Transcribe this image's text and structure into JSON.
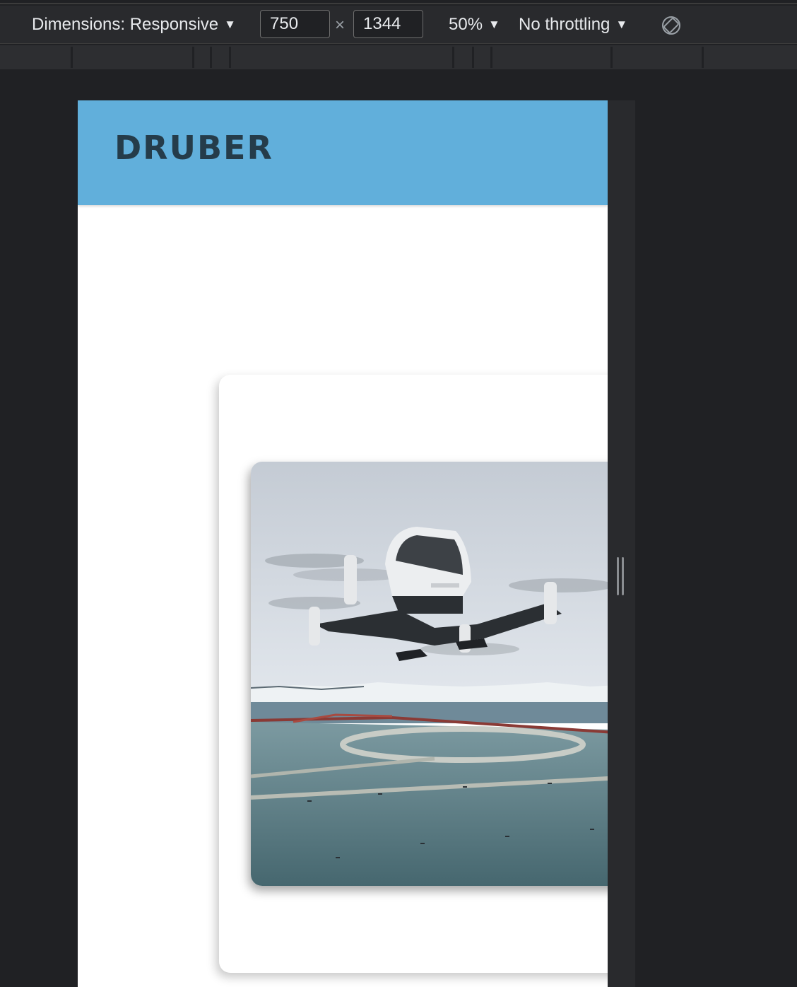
{
  "devtools": {
    "dimensions_label": "Dimensions: Responsive",
    "width_value": "750",
    "height_value": "1344",
    "times_symbol": "×",
    "zoom_label": "50%",
    "throttling_label": "No throttling",
    "caret": "▼",
    "rotate_icon": "rotate-device-icon"
  },
  "site": {
    "brand": "DRUBER",
    "header_color": "#61afdb",
    "hero_image": "passenger-drone-over-helipad"
  }
}
